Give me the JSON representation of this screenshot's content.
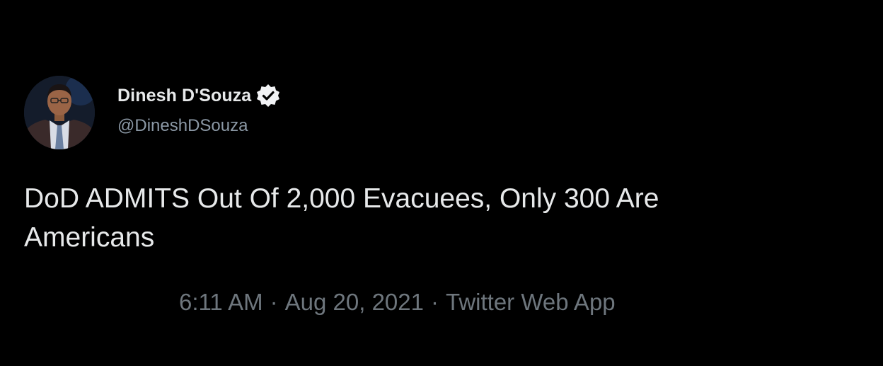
{
  "author": {
    "display_name": "Dinesh D'Souza",
    "handle": "@DineshDSouza",
    "verified_icon": "verified-badge-icon",
    "avatar_icon": "profile-photo"
  },
  "tweet": {
    "text_line1": "DoD ADMITS Out Of 2,000 Evacuees, Only 300 Are",
    "text_line2": "Americans"
  },
  "meta": {
    "time": "6:11 AM",
    "separator": "·",
    "date": "Aug 20, 2021",
    "source": "Twitter Web App"
  },
  "colors": {
    "background": "#000000",
    "primary_text": "#e7e9ea",
    "secondary_text": "#8b98a5",
    "meta_text": "#6e767d"
  }
}
